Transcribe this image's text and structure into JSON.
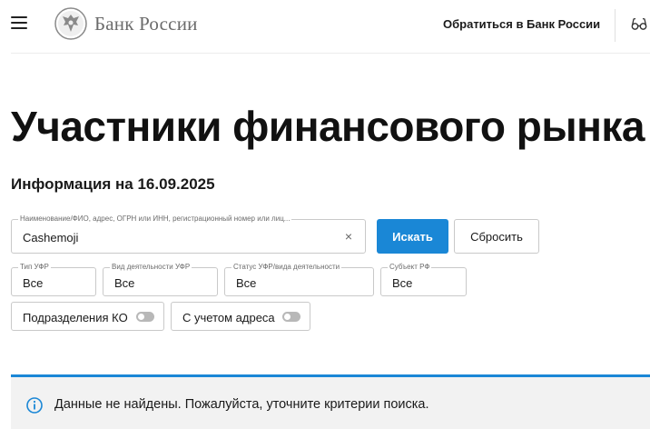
{
  "header": {
    "brand": "Банк России",
    "contact_link": "Обратиться в Банк России"
  },
  "page": {
    "title": "Участники финансового рынка",
    "info_date": "Информация на 16.09.2025"
  },
  "search": {
    "label": "Наименование/ФИО, адрес, ОГРН или ИНН, регистрационный номер или лиц...",
    "value": "Cashemoji",
    "clear_icon": "×",
    "search_button": "Искать",
    "reset_button": "Сбросить"
  },
  "filters": [
    {
      "label": "Тип УФР",
      "value": "Все"
    },
    {
      "label": "Вид деятельности УФР",
      "value": "Все"
    },
    {
      "label": "Статус УФР/вида деятельности",
      "value": "Все"
    },
    {
      "label": "Субъект РФ",
      "value": "Все"
    }
  ],
  "toggles": [
    {
      "label": "Подразделения КО",
      "on": false
    },
    {
      "label": "С учетом адреса",
      "on": false
    }
  ],
  "notice": {
    "text": "Данные не найдены. Пожалуйста, уточните критерии поиска.",
    "icon": "info-icon"
  },
  "colors": {
    "accent": "#1a87d6",
    "notice_bg": "#f2f2f2",
    "brand_text": "#6b6b6b"
  }
}
